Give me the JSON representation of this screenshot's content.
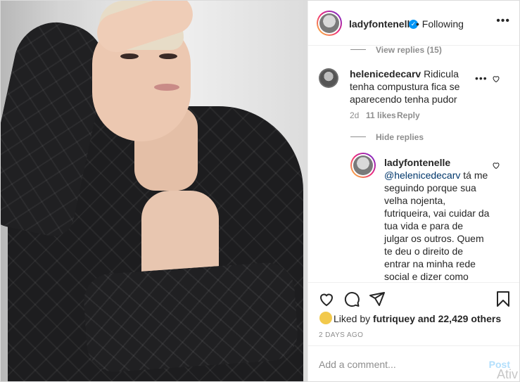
{
  "post": {
    "username": "ladyfontenelle",
    "follow_status": "Following",
    "more_icon": "more-horizontal-icon",
    "verified_icon": "verified-badge-icon"
  },
  "comments": {
    "view_replies": "View replies (15)",
    "comment1": {
      "username": "helenicedecarv",
      "text": "Ridicula tenha compustura fica se aparecendo tenha pudor",
      "age": "2d",
      "likes": "11 likes",
      "reply": "Reply"
    },
    "hide_replies": "Hide replies",
    "reply1": {
      "username": "ladyfontenelle",
      "mention": "@helenicedecarv",
      "text": "tá me seguindo porque sua velha nojenta, futriqueira, vai cuidar da tua vida e para de julgar os outros. Quem te deu o direito de entrar na minha rede social e dizer como devo me comportar. TE MANCA"
    }
  },
  "actions": {
    "like_icon": "heart-icon",
    "comment_icon": "comment-icon",
    "share_icon": "send-icon",
    "save_icon": "bookmark-icon"
  },
  "likes": {
    "prefix": "Liked by",
    "user": "futriquey",
    "suffix": "and 22,429 others"
  },
  "date": "2 DAYS AGO",
  "add_comment": {
    "placeholder": "Add a comment...",
    "post_label": "Post"
  },
  "watermark": "Ativ"
}
